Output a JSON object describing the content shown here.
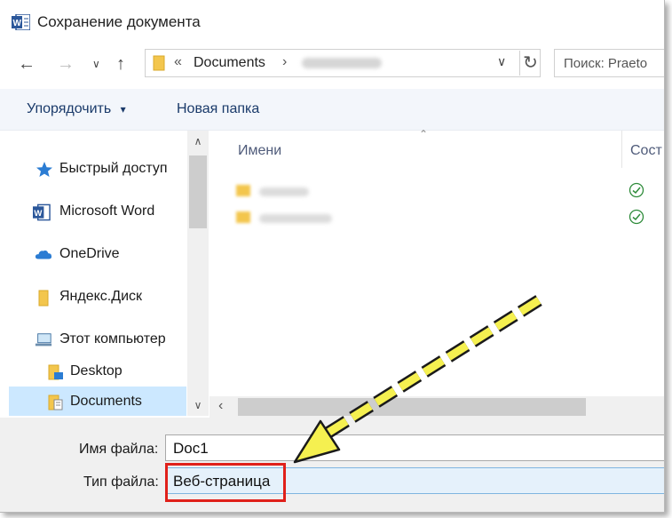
{
  "window": {
    "title": "Сохранение документа"
  },
  "nav": {
    "search_placeholder": "Поиск: Praeto",
    "breadcrumb_sep": "«",
    "breadcrumb": [
      "Documents"
    ]
  },
  "toolbar": {
    "organize": "Упорядочить",
    "organize_caret": "▾",
    "new_folder": "Новая папка"
  },
  "sidebar": {
    "items": [
      {
        "label": "Быстрый доступ",
        "icon": "star-icon"
      },
      {
        "label": "Microsoft Word",
        "icon": "word-icon"
      },
      {
        "label": "OneDrive",
        "icon": "cloud-icon"
      },
      {
        "label": "Яндекс.Диск",
        "icon": "folder-icon"
      },
      {
        "label": "Этот компьютер",
        "icon": "computer-icon"
      },
      {
        "label": "Desktop",
        "icon": "desktop-folder-icon"
      },
      {
        "label": "Documents",
        "icon": "documents-folder-icon",
        "selected": true
      }
    ]
  },
  "files": {
    "columns": [
      "Имени",
      "Сост"
    ],
    "rows": [
      {
        "status": "synced"
      },
      {
        "status": "synced"
      }
    ]
  },
  "form": {
    "filename_label": "Имя файла:",
    "filename_value": "Doc1",
    "filetype_label": "Тип файла:",
    "filetype_value": "Веб-страница"
  },
  "colors": {
    "accent": "#2b579a",
    "highlight": "#e0201a",
    "arrow_fill": "#f5f050"
  }
}
